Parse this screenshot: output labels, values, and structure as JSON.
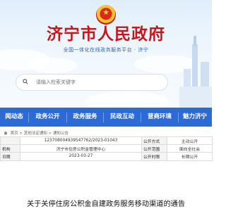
{
  "header": {
    "site_title": "济宁市人民政府",
    "site_subtitle": "全国一体化在线政务服务平台 · 济宁",
    "emblem_icon": "national-emblem-icon"
  },
  "search": {
    "placeholder": "请输入检索关键字",
    "icon": "search-icon"
  },
  "nav": {
    "items": [
      "闻动态",
      "政务公开",
      "政务服务",
      "民政互动",
      "营商环境",
      "魅力济宁"
    ],
    "color": "#2c6ad6"
  },
  "breadcrumb": {
    "text": "首页 > 其他法定通知 > 通知公告"
  },
  "info_table": {
    "rows": [
      {
        "label": "",
        "value": "1237080049395477​62/2023-01043",
        "label2": "公开方式",
        "value2": "主动公开"
      },
      {
        "label": "机构",
        "value": "济宁市住房公积金管理中心",
        "label2": "公开范围",
        "value2": "面向全社会"
      },
      {
        "label": "日期",
        "value": "2023-03-27",
        "label2": "公开时限",
        "value2": "长期公开"
      }
    ]
  },
  "article": {
    "title": "关于关停住房公积金自建政务服务移动渠道的通告"
  }
}
